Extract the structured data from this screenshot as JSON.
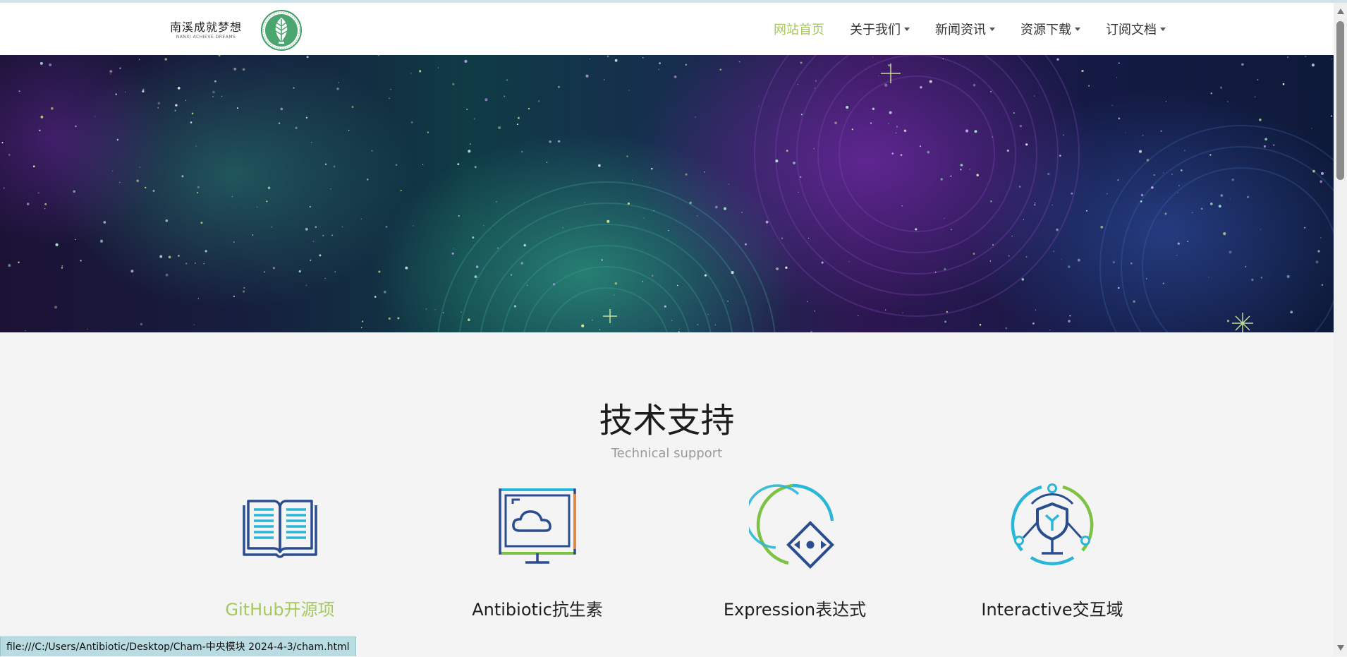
{
  "brand": {
    "name_cn": "南溪成就梦想",
    "name_en": "NANXI ACHIEVE DREAMS",
    "logo_icon": "leaf-logo-icon"
  },
  "nav": {
    "items": [
      {
        "label": "网站首页",
        "active": true,
        "dropdown": false
      },
      {
        "label": "关于我们",
        "active": false,
        "dropdown": true
      },
      {
        "label": "新闻资讯",
        "active": false,
        "dropdown": true
      },
      {
        "label": "资源下载",
        "active": false,
        "dropdown": true
      },
      {
        "label": "订阅文档",
        "active": false,
        "dropdown": true
      }
    ]
  },
  "section": {
    "title": "技术支持",
    "subtitle": "Technical support"
  },
  "features": [
    {
      "label": "GitHub开源项",
      "icon": "open-book-icon",
      "highlight": true
    },
    {
      "label": "Antibiotic抗生素",
      "icon": "cloud-monitor-icon",
      "highlight": false
    },
    {
      "label": "Expression表达式",
      "icon": "refresh-cycle-icon",
      "highlight": false
    },
    {
      "label": "Interactive交互域",
      "icon": "shield-network-icon",
      "highlight": false
    }
  ],
  "status_bar": {
    "url": "file:///C:/Users/Antibiotic/Desktop/Cham-中央模块 2024-4-3/cham.html"
  },
  "colors": {
    "accent": "#a6c85c",
    "dark_blue": "#2a4d8f",
    "cyan": "#29b6d8",
    "green": "#7dc242"
  }
}
